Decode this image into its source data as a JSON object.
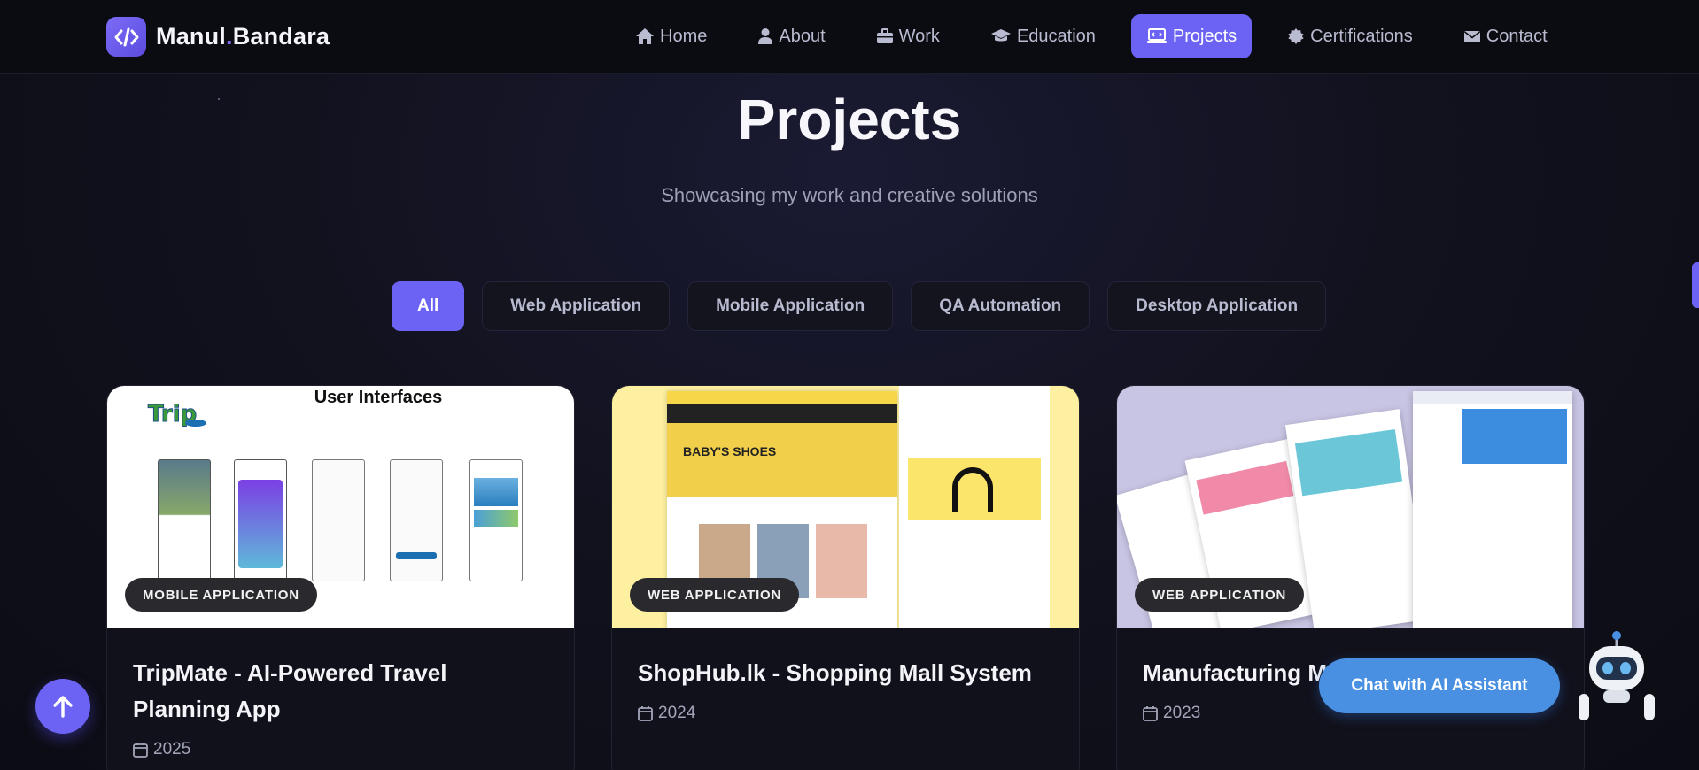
{
  "brand": {
    "name_first": "Manul",
    "name_dot": ".",
    "name_last": "Bandara",
    "logo_icon": "code-icon"
  },
  "nav": [
    {
      "label": "Home",
      "icon": "home-icon"
    },
    {
      "label": "About",
      "icon": "user-icon"
    },
    {
      "label": "Work",
      "icon": "briefcase-icon"
    },
    {
      "label": "Education",
      "icon": "graduation-cap-icon"
    },
    {
      "label": "Projects",
      "icon": "laptop-code-icon",
      "active": true
    },
    {
      "label": "Certifications",
      "icon": "certificate-icon"
    },
    {
      "label": "Contact",
      "icon": "envelope-icon"
    }
  ],
  "header": {
    "title": "Projects",
    "subtitle": "Showcasing my work and creative solutions"
  },
  "filters": [
    {
      "label": "All",
      "active": true
    },
    {
      "label": "Web Application"
    },
    {
      "label": "Mobile Application"
    },
    {
      "label": "QA Automation"
    },
    {
      "label": "Desktop Application"
    }
  ],
  "projects": [
    {
      "badge": "MOBILE APPLICATION",
      "title": "TripMate - AI-Powered Travel Planning App",
      "year": "2025",
      "image_caption": "User Interfaces"
    },
    {
      "badge": "WEB APPLICATION",
      "title": "ShopHub.lk - Shopping Mall System",
      "year": "2024",
      "image_caption": "BABY'S SHOES"
    },
    {
      "badge": "WEB APPLICATION",
      "title": "Manufacturing M",
      "year": "2023",
      "image_caption": ""
    }
  ],
  "floating": {
    "chat_label": "Chat with  AI Assistant",
    "scroll_top_icon": "arrow-up-icon",
    "robot_icon": "robot-icon"
  },
  "colors": {
    "accent": "#6c63f4",
    "chat": "#4a90e2",
    "background": "#0d0d16"
  }
}
